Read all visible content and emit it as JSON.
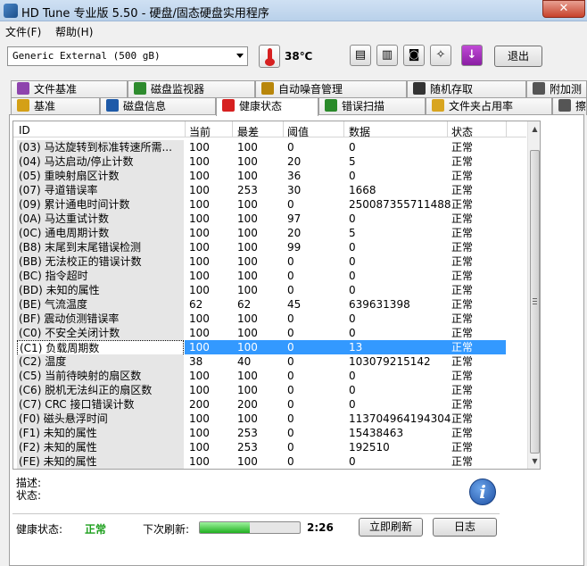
{
  "window": {
    "title": "HD Tune 专业版 5.50 - 硬盘/固态硬盘实用程序",
    "close_glyph": "✕"
  },
  "menu": [
    {
      "label": "文件(F)"
    },
    {
      "label": "帮助(H)"
    }
  ],
  "toolbar": {
    "drive": "Generic External (500 gB)",
    "temperature": "38℃",
    "exit_label": "退出",
    "icons": [
      "copy-text-icon",
      "copy-screen-icon",
      "camera-icon",
      "tools-icon",
      "download-icon"
    ]
  },
  "tabs_top": [
    {
      "label": "文件基准",
      "icon": "file-benchmark-icon",
      "color": "#8e44ad"
    },
    {
      "label": "磁盘监视器",
      "icon": "disk-monitor-icon",
      "color": "#2e8b2e"
    },
    {
      "label": "自动噪音管理",
      "icon": "speaker-icon",
      "color": "#b8860b"
    },
    {
      "label": "随机存取",
      "icon": "random-access-icon",
      "color": "#333333"
    },
    {
      "label": "附加测",
      "icon": "extra-tests-icon",
      "color": "#555555"
    }
  ],
  "tabs_bottom": [
    {
      "label": "基准",
      "icon": "benchmark-icon",
      "color": "#d4a017"
    },
    {
      "label": "磁盘信息",
      "icon": "info-icon",
      "color": "#1e5aa8"
    },
    {
      "label": "健康状态",
      "icon": "health-cross-icon",
      "color": "#d62020",
      "active": true
    },
    {
      "label": "错误扫描",
      "icon": "magnifier-icon",
      "color": "#2a8a2a"
    },
    {
      "label": "文件夹占用率",
      "icon": "folder-icon",
      "color": "#d8a520"
    },
    {
      "label": "擦",
      "icon": "trash-icon",
      "color": "#555555"
    }
  ],
  "table": {
    "headers": [
      "ID",
      "当前",
      "最差",
      "阈值",
      "数据",
      "状态"
    ],
    "rows": [
      {
        "id": "(03) 马达旋转到标准转速所需...",
        "current": "100",
        "worst": "100",
        "threshold": "0",
        "data": "0",
        "status": "正常"
      },
      {
        "id": "(04) 马达启动/停止计数",
        "current": "100",
        "worst": "100",
        "threshold": "20",
        "data": "5",
        "status": "正常"
      },
      {
        "id": "(05) 重映射扇区计数",
        "current": "100",
        "worst": "100",
        "threshold": "36",
        "data": "0",
        "status": "正常"
      },
      {
        "id": "(07) 寻道错误率",
        "current": "100",
        "worst": "253",
        "threshold": "30",
        "data": "1668",
        "status": "正常"
      },
      {
        "id": "(09) 累计通电时间计数",
        "current": "100",
        "worst": "100",
        "threshold": "0",
        "data": "250087355711488",
        "status": "正常"
      },
      {
        "id": "(0A) 马达重试计数",
        "current": "100",
        "worst": "100",
        "threshold": "97",
        "data": "0",
        "status": "正常"
      },
      {
        "id": "(0C) 通电周期计数",
        "current": "100",
        "worst": "100",
        "threshold": "20",
        "data": "5",
        "status": "正常"
      },
      {
        "id": "(B8) 末尾到末尾错误检测",
        "current": "100",
        "worst": "100",
        "threshold": "99",
        "data": "0",
        "status": "正常"
      },
      {
        "id": "(BB) 无法校正的错误计数",
        "current": "100",
        "worst": "100",
        "threshold": "0",
        "data": "0",
        "status": "正常"
      },
      {
        "id": "(BC) 指令超时",
        "current": "100",
        "worst": "100",
        "threshold": "0",
        "data": "0",
        "status": "正常"
      },
      {
        "id": "(BD) 未知的属性",
        "current": "100",
        "worst": "100",
        "threshold": "0",
        "data": "0",
        "status": "正常"
      },
      {
        "id": "(BE) 气流温度",
        "current": "62",
        "worst": "62",
        "threshold": "45",
        "data": "639631398",
        "status": "正常"
      },
      {
        "id": "(BF) 震动侦测错误率",
        "current": "100",
        "worst": "100",
        "threshold": "0",
        "data": "0",
        "status": "正常"
      },
      {
        "id": "(C0) 不安全关闭计数",
        "current": "100",
        "worst": "100",
        "threshold": "0",
        "data": "0",
        "status": "正常"
      },
      {
        "id": "(C1) 负载周期数",
        "current": "100",
        "worst": "100",
        "threshold": "0",
        "data": "13",
        "status": "正常",
        "selected": true
      },
      {
        "id": "(C2) 温度",
        "current": "38",
        "worst": "40",
        "threshold": "0",
        "data": "103079215142",
        "status": "正常"
      },
      {
        "id": "(C5) 当前待映射的扇区数",
        "current": "100",
        "worst": "100",
        "threshold": "0",
        "data": "0",
        "status": "正常"
      },
      {
        "id": "(C6) 脱机无法纠正的扇区数",
        "current": "100",
        "worst": "100",
        "threshold": "0",
        "data": "0",
        "status": "正常"
      },
      {
        "id": "(C7) CRC 接口错误计数",
        "current": "200",
        "worst": "200",
        "threshold": "0",
        "data": "0",
        "status": "正常"
      },
      {
        "id": "(F0) 磁头悬浮时间",
        "current": "100",
        "worst": "100",
        "threshold": "0",
        "data": "113704964194304",
        "status": "正常"
      },
      {
        "id": "(F1) 未知的属性",
        "current": "100",
        "worst": "253",
        "threshold": "0",
        "data": "15438463",
        "status": "正常"
      },
      {
        "id": "(F2) 未知的属性",
        "current": "100",
        "worst": "253",
        "threshold": "0",
        "data": "192510",
        "status": "正常"
      },
      {
        "id": "(FE) 未知的属性",
        "current": "100",
        "worst": "100",
        "threshold": "0",
        "data": "0",
        "status": "正常"
      }
    ]
  },
  "details": {
    "description_label": "描述:",
    "status_label": "状态:"
  },
  "footer": {
    "health_label": "健康状态:",
    "health_value": "正常",
    "health_color": "#1ea01e",
    "next_refresh_label": "下次刷新:",
    "refresh_progress": 0.5,
    "countdown": "2:26",
    "refresh_now_label": "立即刷新",
    "log_label": "日志"
  }
}
